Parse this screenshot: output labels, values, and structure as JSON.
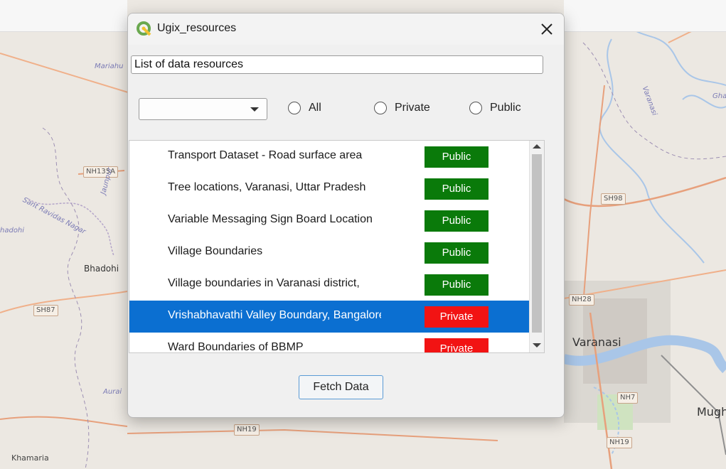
{
  "dialog": {
    "title": "Ugix_resources",
    "search_value": "List of data resources",
    "filter_selected": "",
    "radios": [
      {
        "label": "All",
        "checked": false
      },
      {
        "label": "Private",
        "checked": false
      },
      {
        "label": "Public",
        "checked": false
      }
    ],
    "rows": [
      {
        "name": "Transport Dataset - Road surface area",
        "access": "Public",
        "selected": false
      },
      {
        "name": "Tree locations, Varanasi, Uttar Pradesh",
        "access": "Public",
        "selected": false
      },
      {
        "name": "Variable Messaging Sign Board Location",
        "access": "Public",
        "selected": false
      },
      {
        "name": "Village Boundaries",
        "access": "Public",
        "selected": false
      },
      {
        "name": "Village boundaries in Varanasi district,",
        "access": "Public",
        "selected": false
      },
      {
        "name": "Vrishabhavathi Valley Boundary, Bangalore",
        "access": "Private",
        "selected": true
      },
      {
        "name": "Ward Boundaries of BBMP",
        "access": "Private",
        "selected": false
      }
    ],
    "fetch_label": "Fetch Data",
    "colors": {
      "public": "#0a7a0a",
      "private": "#f21313",
      "selected": "#0b6fd1"
    }
  },
  "map": {
    "labels": {
      "mariahu": "Mariahu",
      "nh135a": "NH135A",
      "jaunpur": "Jaunpur",
      "sant_ravidas": "Sant Ravidas Nagar",
      "hadohi": "hadohi",
      "bhadohi": "Bhadohi",
      "sh87": "SH87",
      "aurai": "Aurai",
      "nh19_left": "NH19",
      "khamaria": "Khamaria",
      "varanasi_river": "Varanasi",
      "gha": "Gha",
      "sh98": "SH98",
      "nh28": "NH28",
      "varanasi": "Varanasi",
      "nh7": "NH7",
      "mugh": "Mugh",
      "nh19_right": "NH19"
    }
  }
}
